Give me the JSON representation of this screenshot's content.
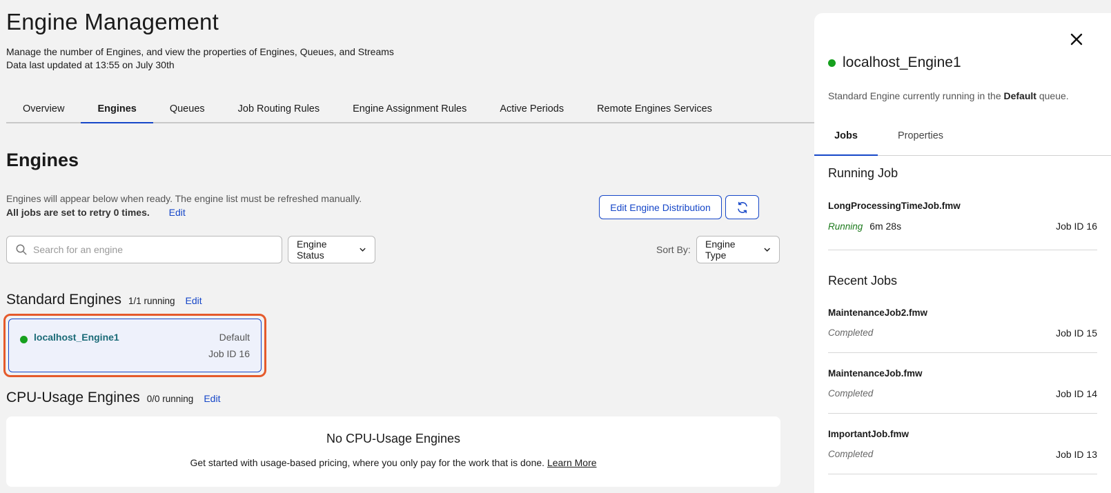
{
  "header": {
    "title": "Engine Management",
    "subtitle_line1": "Manage the number of Engines, and view the properties of Engines, Queues, and Streams",
    "subtitle_line2": "Data last updated at 13:55 on July 30th"
  },
  "tabs": [
    {
      "label": "Overview",
      "active": false
    },
    {
      "label": "Engines",
      "active": true
    },
    {
      "label": "Queues",
      "active": false
    },
    {
      "label": "Job Routing Rules",
      "active": false
    },
    {
      "label": "Engine Assignment Rules",
      "active": false
    },
    {
      "label": "Active Periods",
      "active": false
    },
    {
      "label": "Remote Engines Services",
      "active": false
    }
  ],
  "engines": {
    "title": "Engines",
    "hint": "Engines will appear below when ready. The engine list must be refreshed manually.",
    "retry_note": "All jobs are set to retry 0 times.",
    "edit_label": "Edit",
    "edit_distribution_label": "Edit Engine Distribution",
    "refresh_icon": "refresh-icon",
    "search_placeholder": "Search for an engine",
    "status_filter": "Engine Status",
    "sort_by_label": "Sort By:",
    "sort_by_value": "Engine Type"
  },
  "standard": {
    "title": "Standard Engines",
    "count": "1/1 running",
    "edit_label": "Edit",
    "cards": [
      {
        "name": "localhost_Engine1",
        "queue": "Default",
        "job": "Job ID 16",
        "status_color": "#16a01e"
      }
    ]
  },
  "cpu": {
    "title": "CPU-Usage Engines",
    "count": "0/0 running",
    "edit_label": "Edit",
    "empty_title": "No CPU-Usage Engines",
    "empty_desc": "Get started with usage-based pricing, where you only pay for the work that is done.",
    "learn_more": "Learn More"
  },
  "panel": {
    "title": "localhost_Engine1",
    "desc_prefix": "Standard Engine currently running in the",
    "desc_queue": "Default",
    "desc_suffix": "queue.",
    "tabs": [
      "Jobs",
      "Properties"
    ],
    "running_title": "Running Job",
    "running_job": {
      "name": "LongProcessingTimeJob.fmw",
      "status": "Running",
      "duration": "6m 28s",
      "job": "Job ID 16"
    },
    "recent_title": "Recent Jobs",
    "recent_jobs": [
      {
        "name": "MaintenanceJob2.fmw",
        "status": "Completed",
        "job": "Job ID 15"
      },
      {
        "name": "MaintenanceJob.fmw",
        "status": "Completed",
        "job": "Job ID 14"
      },
      {
        "name": "ImportantJob.fmw",
        "status": "Completed",
        "job": "Job ID 13"
      }
    ]
  },
  "colors": {
    "accent": "#1546c8",
    "running": "#16a01e",
    "highlight": "#e55a2b"
  }
}
